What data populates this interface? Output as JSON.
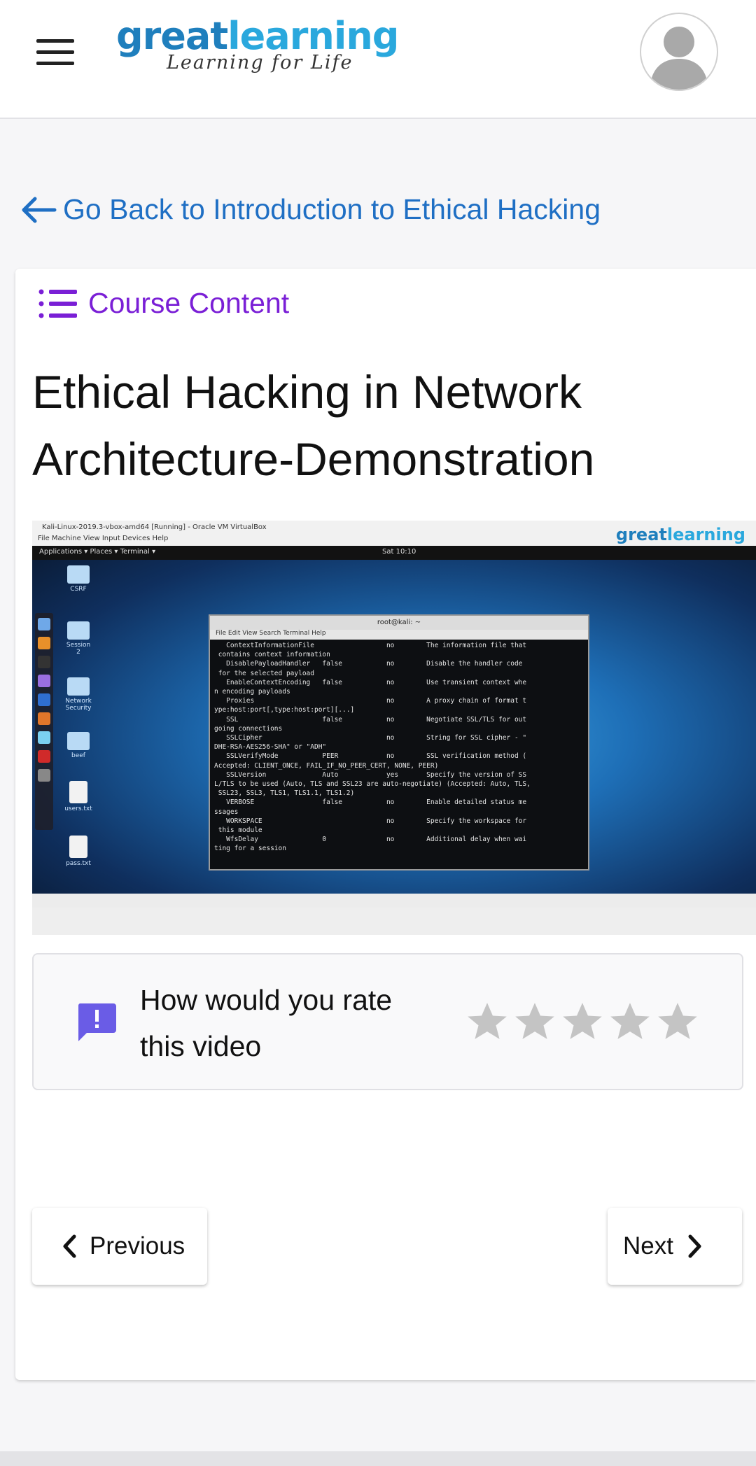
{
  "header": {
    "menu_icon": "hamburger-icon",
    "logo_part1": "great",
    "logo_part2": "learning",
    "logo_tagline": "Learning for Life",
    "avatar_icon": "user-avatar-icon"
  },
  "back_link": {
    "icon": "arrow-left-icon",
    "label": "Go Back to Introduction to Ethical Hacking"
  },
  "card": {
    "course_content_icon": "list-icon",
    "course_content_label": "Course Content",
    "title": "Ethical Hacking in Network Architecture-Demonstration"
  },
  "video": {
    "window_title": "Kali-Linux-2019.3-vbox-amd64 [Running] - Oracle VM VirtualBox",
    "window_menu": "File   Machine   View   Input   Devices   Help",
    "watermark_part1": "great",
    "watermark_part2": "learning",
    "topbar_left": "Applications ▾    Places ▾    Terminal ▾",
    "topbar_clock": "Sat 10:10",
    "desktop_icons": [
      "CSRF",
      "Session 2",
      "Network Security",
      "beef",
      "users.txt",
      "pass.txt"
    ],
    "terminal_title": "root@kali: ~",
    "terminal_menu": "File   Edit   View   Search   Terminal   Help",
    "terminal_lines": [
      "   ContextInformationFile                  no        The information file that",
      " contains context information",
      "   DisablePayloadHandler   false           no        Disable the handler code",
      " for the selected payload",
      "   EnableContextEncoding   false           no        Use transient context whe",
      "n encoding payloads",
      "   Proxies                                 no        A proxy chain of format t",
      "ype:host:port[,type:host:port][...]",
      "   SSL                     false           no        Negotiate SSL/TLS for out",
      "going connections",
      "   SSLCipher                               no        String for SSL cipher - \"",
      "DHE-RSA-AES256-SHA\" or \"ADH\"",
      "   SSLVerifyMode           PEER            no        SSL verification method (",
      "Accepted: CLIENT_ONCE, FAIL_IF_NO_PEER_CERT, NONE, PEER)",
      "   SSLVersion              Auto            yes       Specify the version of SS",
      "L/TLS to be used (Auto, TLS and SSL23 are auto-negotiate) (Accepted: Auto, TLS,",
      " SSL23, SSL3, TLS1, TLS1.1, TLS1.2)",
      "   VERBOSE                 false           no        Enable detailed status me",
      "ssages",
      "   WORKSPACE                               no        Specify the workspace for",
      " this module",
      "   WfsDelay                0               no        Additional delay when wai",
      "ting for a session"
    ]
  },
  "rating": {
    "icon": "feedback-icon",
    "prompt": "How would you rate this video",
    "stars_total": 5,
    "stars_selected": 0,
    "star_color": "#c4c4c4",
    "icon_color": "#6a5ce6"
  },
  "nav": {
    "previous_label": "Previous",
    "previous_icon": "chevron-left-icon",
    "next_label": "Next",
    "next_icon": "chevron-right-icon"
  },
  "colors": {
    "link_blue": "#1f6fc4",
    "course_purple": "#7a1fd6",
    "logo_blue": "#1f7fbd",
    "logo_light_blue": "#2aa8dd"
  }
}
